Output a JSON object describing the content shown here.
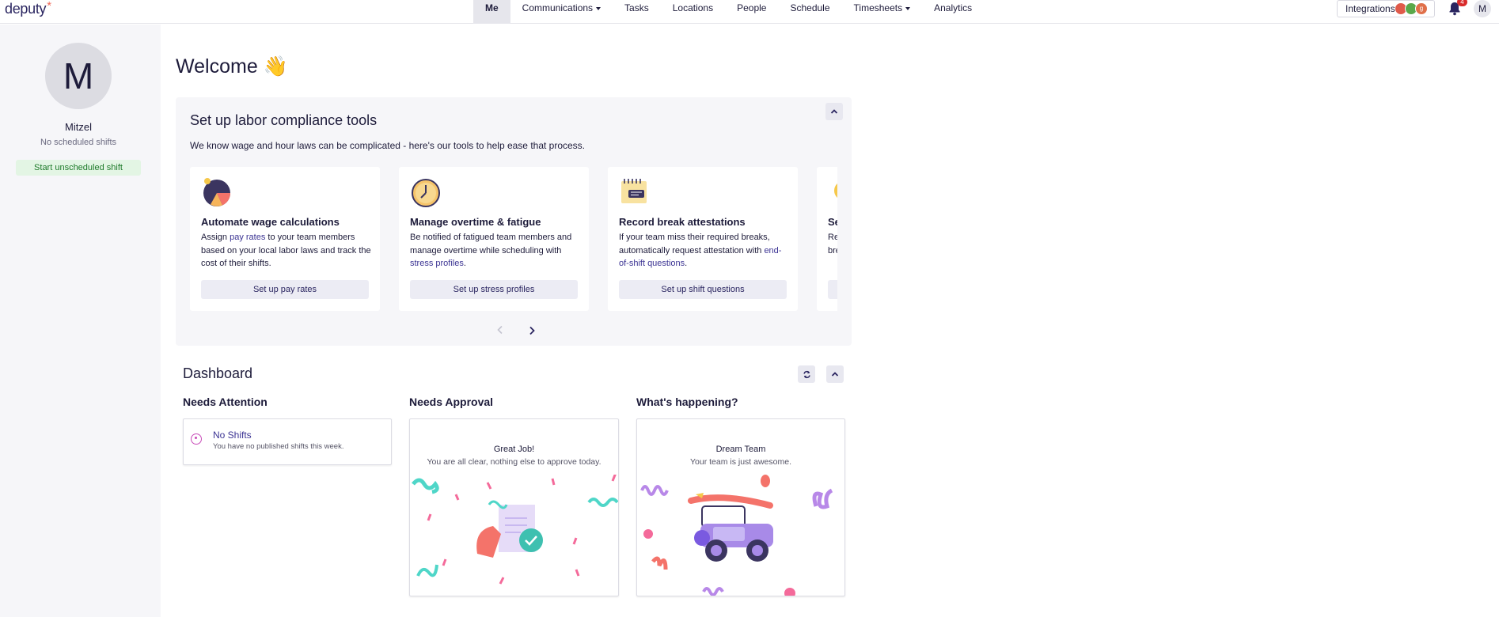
{
  "app": {
    "logo_text": "deputy",
    "logo_mark": "*"
  },
  "nav": {
    "items": [
      {
        "label": "Me",
        "active": true
      },
      {
        "label": "Communications",
        "dropdown": true
      },
      {
        "label": "Tasks"
      },
      {
        "label": "Locations"
      },
      {
        "label": "People"
      },
      {
        "label": "Schedule"
      },
      {
        "label": "Timesheets",
        "dropdown": true
      },
      {
        "label": "Analytics"
      }
    ],
    "integrations_label": "Integrations",
    "integration_badges": [
      "",
      "",
      "g"
    ],
    "notifications_count": "4",
    "avatar_initial": "M"
  },
  "sidebar": {
    "avatar_initial": "M",
    "user_name": "Mitzel",
    "status": "No scheduled shifts",
    "start_shift_label": "Start unscheduled shift"
  },
  "welcome": {
    "title": "Welcome",
    "emoji": "👋"
  },
  "compliance": {
    "title": "Set up labor compliance tools",
    "subtitle": "We know wage and hour laws can be complicated - here's our tools to help ease that process.",
    "cards": [
      {
        "icon": "pie-chart-icon",
        "title": "Automate wage calculations",
        "desc_parts": [
          "Assign ",
          "pay rates",
          " to your team members based on your local labor laws and track the cost of their shifts."
        ],
        "button": "Set up pay rates"
      },
      {
        "icon": "clock-icon",
        "title": "Manage overtime & fatigue",
        "desc_parts": [
          "Be notified of fatigued team members and manage overtime while scheduling with ",
          "stress profiles",
          "."
        ],
        "button": "Set up stress profiles"
      },
      {
        "icon": "notepad-icon",
        "title": "Record break attestations",
        "desc_parts": [
          "If your team miss their required breaks, automatically request attestation with ",
          "end-of-shift questions",
          "."
        ],
        "button": "Set up shift questions"
      },
      {
        "icon": "lightbulb-icon",
        "title": "Se",
        "desc_parts": [
          "Re",
          "",
          "bre"
        ],
        "button": ""
      }
    ]
  },
  "dashboard": {
    "title": "Dashboard",
    "columns": {
      "attention": {
        "title": "Needs Attention",
        "item_title": "No Shifts",
        "item_sub": "You have no published shifts this week."
      },
      "approval": {
        "title": "Needs Approval",
        "card_title": "Great Job!",
        "card_sub": "You are all clear, nothing else to approve today."
      },
      "happening": {
        "title": "What's happening?",
        "card_title": "Dream Team",
        "card_sub": "Your team is just awesome."
      }
    }
  },
  "colors": {
    "brand": "#2a2560",
    "accent_link": "#3b3393",
    "success_bg": "#e3f5e4",
    "success_text": "#1e7a2a",
    "notification": "#d92b2b"
  }
}
